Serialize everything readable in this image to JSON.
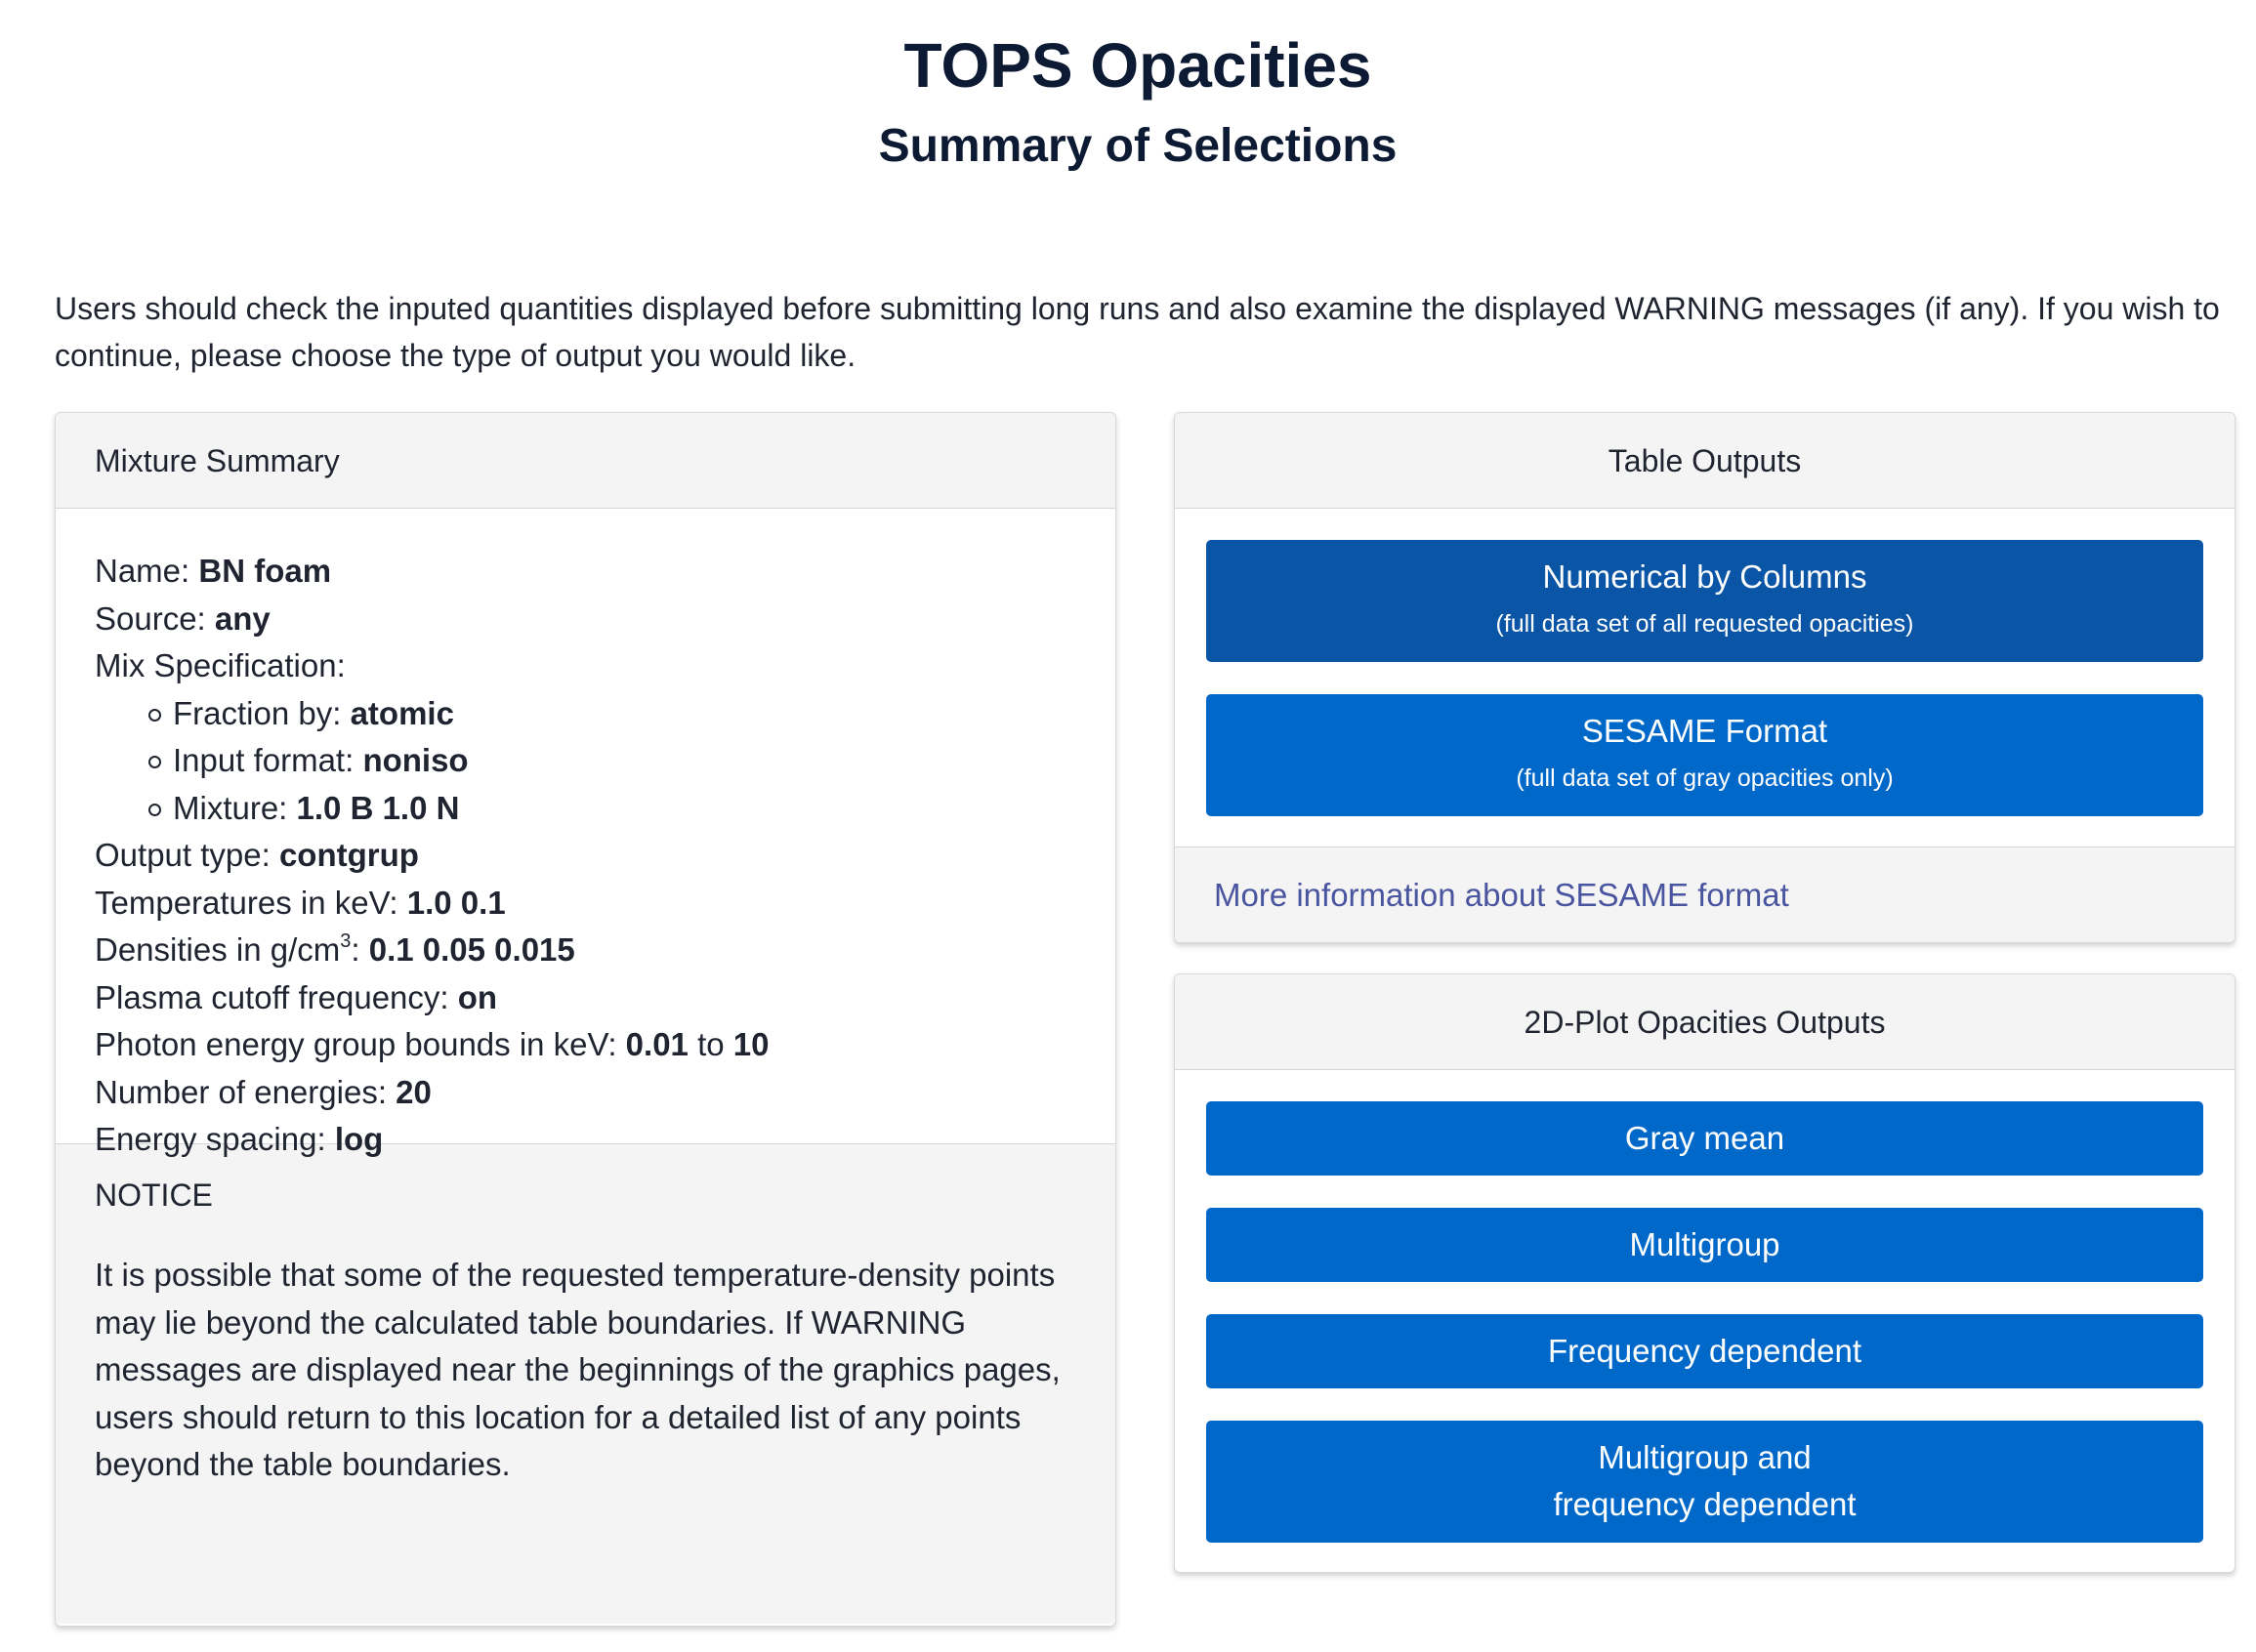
{
  "header": {
    "title": "TOPS Opacities",
    "subtitle": "Summary of Selections"
  },
  "intro": "Users should check the inputed quantities displayed before submitting long runs and also examine the displayed WARNING messages (if any). If you wish to continue, please choose the type of output you would like.",
  "mixture_summary": {
    "header": "Mixture Summary",
    "name_label": "Name: ",
    "name_value": "BN foam",
    "source_label": "Source: ",
    "source_value": "any",
    "mix_spec_label": "Mix Specification:",
    "fraction_label": "Fraction by: ",
    "fraction_value": "atomic",
    "input_format_label": "Input format: ",
    "input_format_value": "noniso",
    "mixture_label": "Mixture: ",
    "mixture_value": "1.0 B 1.0 N",
    "output_type_label": "Output type: ",
    "output_type_value": "contgrup",
    "temperatures_label": "Temperatures in keV: ",
    "temperatures_value": "1.0 0.1",
    "densities_label": "Densities in g/cm",
    "densities_sup": "3",
    "densities_colon": ": ",
    "densities_value": "0.1 0.05 0.015",
    "plasma_label": "Plasma cutoff frequency: ",
    "plasma_value": "on",
    "photon_label": "Photon energy group bounds in keV: ",
    "photon_low": "0.01",
    "photon_to": " to ",
    "photon_high": "10",
    "num_energies_label": "Number of energies: ",
    "num_energies_value": "20",
    "spacing_label": "Energy spacing: ",
    "spacing_value": "log"
  },
  "notice": {
    "title": "NOTICE",
    "text": "It is possible that some of the requested temperature-density points may lie beyond the calculated table boundaries. If WARNING messages are displayed near the beginnings of the graphics pages, users should return to this location for a detailed list of any points beyond the table boundaries."
  },
  "table_outputs": {
    "header": "Table Outputs",
    "numerical_label": "Numerical by Columns",
    "numerical_sub": "(full data set of all requested opacities)",
    "sesame_label": "SESAME Format",
    "sesame_sub": "(full data set of gray opacities only)",
    "more_info_link": "More information about SESAME format"
  },
  "plot_outputs": {
    "header": "2D-Plot Opacities Outputs",
    "gray_mean": "Gray mean",
    "multigroup": "Multigroup",
    "frequency_dependent": "Frequency dependent",
    "multi_freq_line1": "Multigroup and",
    "multi_freq_line2": "frequency dependent"
  },
  "colors": {
    "button": "#0068c8",
    "button_active": "#0a55a5",
    "link": "#4a55a0",
    "header_bg": "#f4f4f4"
  }
}
